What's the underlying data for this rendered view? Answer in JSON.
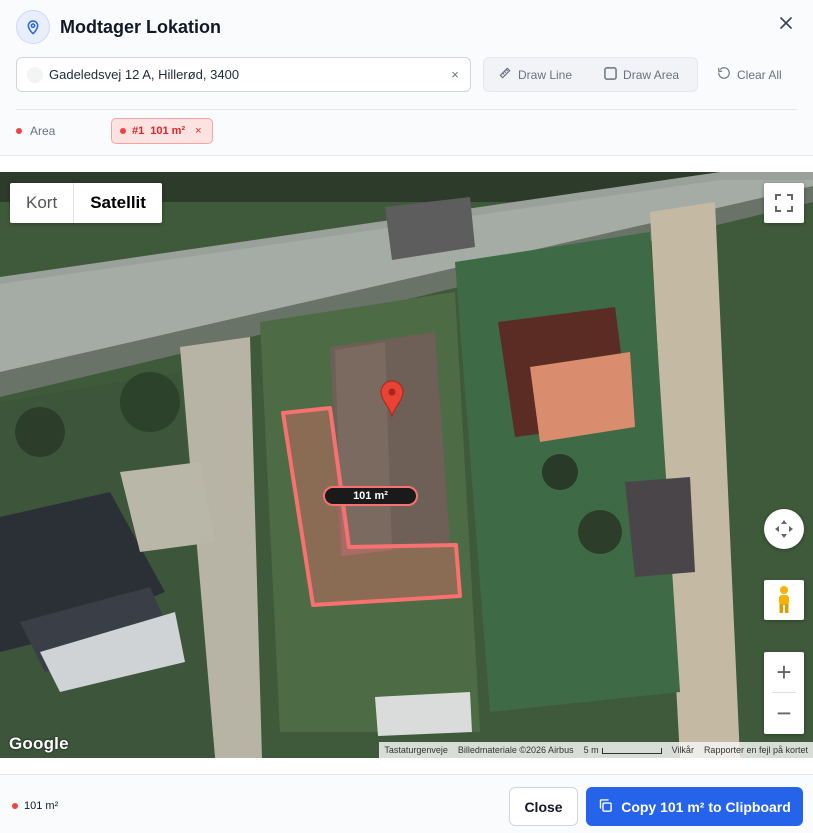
{
  "dialog": {
    "title": "Modtager Lokation",
    "title_icon": "map-pin-icon",
    "close_icon": "close-icon"
  },
  "search": {
    "value": "Gadeledsvej 12 A, Hillerød, 3400",
    "clear_symbol": "×"
  },
  "tools": {
    "draw_line": "Draw Line",
    "draw_area": "Draw Area",
    "clear_all": "Clear All"
  },
  "legend": {
    "label": "Area",
    "color": "#ef4444"
  },
  "shapes": [
    {
      "index": "#1",
      "value": "101 m²",
      "remove": "×"
    }
  ],
  "map": {
    "type_options": [
      "Kort",
      "Satellit"
    ],
    "selected_type": "Satellit",
    "area_label": "101 m²",
    "zoom_in": "+",
    "zoom_out": "−",
    "logo": "Google",
    "attribution": {
      "shortcuts": "Tastaturgenveje",
      "imagery": "Billedmateriale ©2026 Airbus",
      "scale": "5 m",
      "terms": "Vilkår",
      "report": "Rapporter en fejl på kortet"
    }
  },
  "footer": {
    "total": "101 m²",
    "close_label": "Close",
    "copy_label": "Copy 101 m² to Clipboard",
    "accent": "#2563eb"
  }
}
